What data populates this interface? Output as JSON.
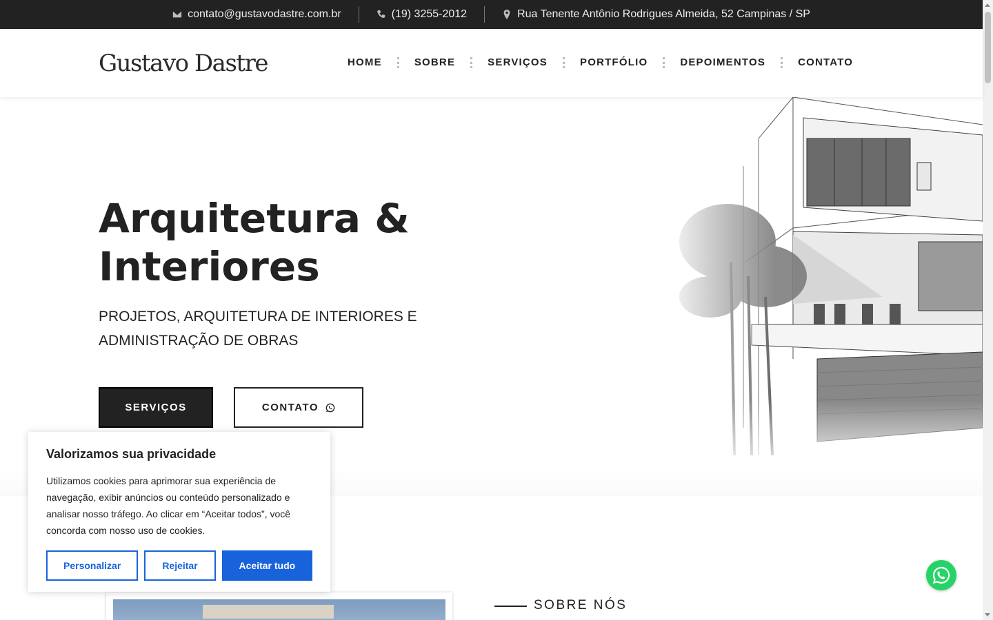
{
  "topbar": {
    "email": "contato@gustavodastre.com.br",
    "phone": "(19) 3255-2012",
    "address": "Rua Tenente Antônio Rodrigues Almeida, 52 Campinas / SP"
  },
  "header": {
    "logo": "Gustavo Dastre",
    "nav": [
      "HOME",
      "SOBRE",
      "SERVIÇOS",
      "PORTFÓLIO",
      "DEPOIMENTOS",
      "CONTATO"
    ]
  },
  "hero": {
    "title_line1": "Arquitetura &",
    "title_line2": "Interiores",
    "subtitle_line1": "PROJETOS, ARQUITETURA DE INTERIORES E",
    "subtitle_line2": "ADMINISTRAÇÃO DE OBRAS",
    "btn_services": "SERVIÇOS",
    "btn_contact": "CONTATO"
  },
  "cookie": {
    "title": "Valorizamos sua privacidade",
    "text": "Utilizamos cookies para aprimorar sua experiência de navegação, exibir anúncios ou conteúdo personalizado e analisar nosso tráfego. Ao clicar em “Aceitar todos”, você concorda com nosso uso de cookies.",
    "btn_customize": "Personalizar",
    "btn_reject": "Rejeitar",
    "btn_accept": "Aceitar tudo"
  },
  "about": {
    "label": "SOBRE NÓS"
  },
  "icons": {
    "email": "envelope-icon",
    "phone": "phone-icon",
    "address": "map-pin-icon",
    "contact_btn": "whatsapp-icon",
    "float": "whatsapp-icon"
  },
  "colors": {
    "dark": "#222222",
    "cookie_accent": "#1863dc",
    "whatsapp": "#25d366"
  }
}
